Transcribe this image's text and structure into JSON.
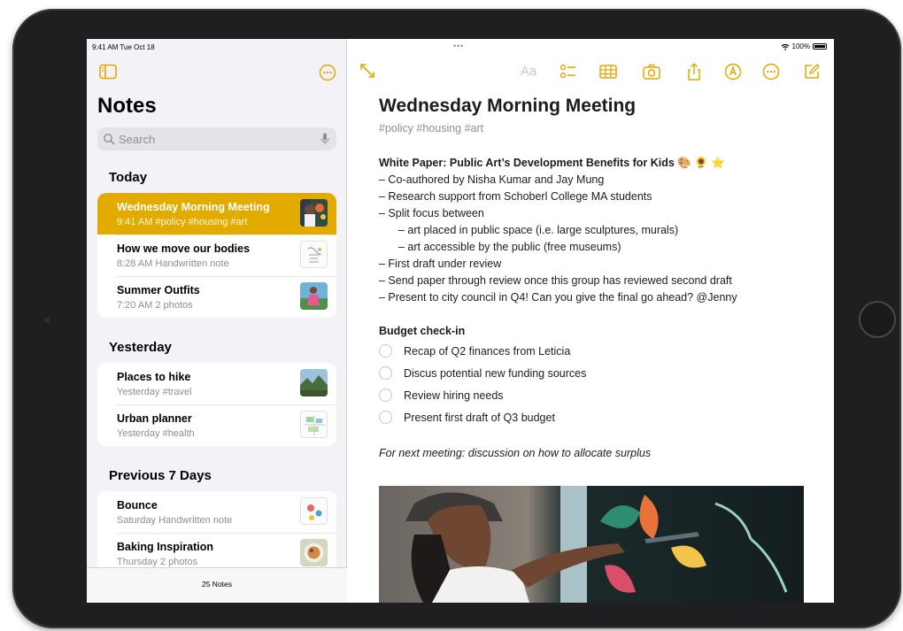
{
  "status_bar": {
    "time": "9:41 AM  Tue Oct 18",
    "dots": "•••",
    "battery": "100%"
  },
  "sidebar": {
    "title": "Notes",
    "search_placeholder": "Search",
    "sections": [
      {
        "heading": "Today",
        "items": [
          {
            "title": "Wednesday Morning Meeting",
            "subtitle": "9:41 AM  #policy #housing #art",
            "selected": true,
            "thumb": "mural-photo"
          },
          {
            "title": "How we move our bodies",
            "subtitle": "8:28 AM  Handwritten note",
            "thumb": "sketch"
          },
          {
            "title": "Summer Outfits",
            "subtitle": "7:20 AM  2 photos",
            "thumb": "outfit-photo"
          }
        ]
      },
      {
        "heading": "Yesterday",
        "items": [
          {
            "title": "Places to hike",
            "subtitle": "Yesterday  #travel",
            "thumb": "landscape-photo"
          },
          {
            "title": "Urban planner",
            "subtitle": "Yesterday  #health",
            "thumb": "map-sketch"
          }
        ]
      },
      {
        "heading": "Previous 7 Days",
        "items": [
          {
            "title": "Bounce",
            "subtitle": "Saturday  Handwritten note",
            "thumb": "drawing"
          },
          {
            "title": "Baking Inspiration",
            "subtitle": "Thursday  2 photos",
            "thumb": "food-photo"
          }
        ]
      }
    ],
    "footer": "25 Notes"
  },
  "toolbar": {
    "format_label": "Aa",
    "icons": [
      "expand-icon",
      "format-icon",
      "checklist-icon",
      "table-icon",
      "camera-icon",
      "share-icon",
      "markup-icon",
      "more-icon",
      "compose-icon"
    ]
  },
  "note": {
    "title": "Wednesday Morning Meeting",
    "tags": "#policy #housing #art",
    "lines": [
      {
        "text": "White Paper: Public Art’s Development Benefits for Kids 🎨 🌻 ⭐",
        "style": "bold",
        "indent": 0
      },
      {
        "text": "– Co-authored by Nisha Kumar and Jay Mung",
        "indent": 0
      },
      {
        "text": "– Research support from Schoberl College MA students",
        "indent": 0
      },
      {
        "text": "– Split focus between",
        "indent": 0
      },
      {
        "text": "– art placed in public space (i.e. large sculptures, murals)",
        "indent": 1
      },
      {
        "text": "– art accessible by the public (free museums)",
        "indent": 1
      },
      {
        "text": "– First draft under review",
        "indent": 0
      },
      {
        "text": "– Send paper through review once this group has reviewed second draft",
        "indent": 0
      },
      {
        "text": "– Present to city council in Q4! Can you give the final go ahead? @Jenny",
        "indent": 0
      }
    ],
    "budget_heading": "Budget check-in",
    "checklist": [
      "Recap of Q2 finances from Leticia",
      "Discus potential new funding sources",
      "Review hiring needs",
      "Present first draft of Q3 budget"
    ],
    "next_meeting": "For next meeting: discussion on how to allocate surplus"
  },
  "colors": {
    "accent": "#e6a700",
    "selected_row": "#e3ab00",
    "sidebar_bg": "#f2f2f7"
  }
}
